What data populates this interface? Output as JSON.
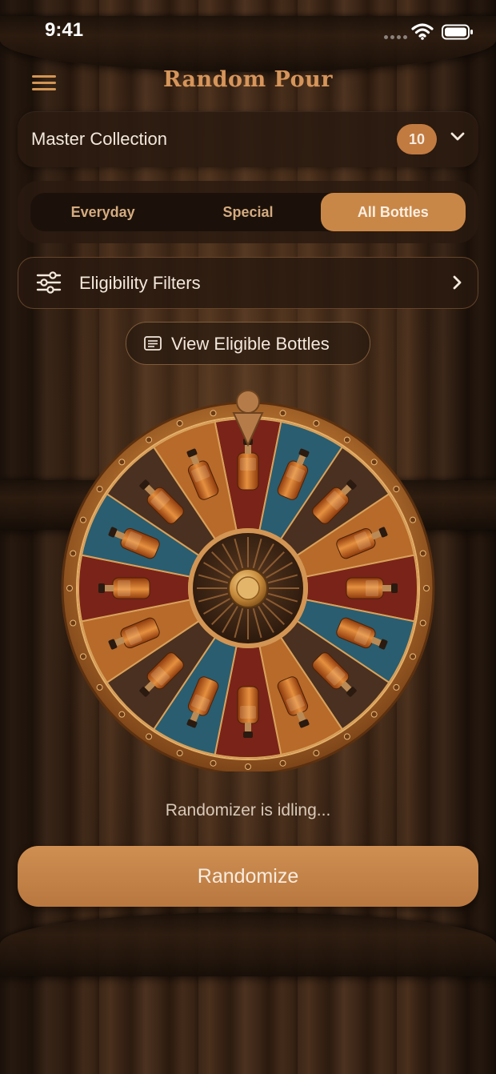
{
  "status_bar": {
    "time": "9:41"
  },
  "header": {
    "title": "Random Pour"
  },
  "collection": {
    "name": "Master Collection",
    "count": "10"
  },
  "segments": [
    {
      "label": "Everyday",
      "active": false
    },
    {
      "label": "Special",
      "active": false
    },
    {
      "label": "All Bottles",
      "active": true
    }
  ],
  "filters": {
    "label": "Eligibility Filters"
  },
  "view_button": {
    "label": "View Eligible Bottles"
  },
  "wheel": {
    "segment_count": 16,
    "colors": [
      "#7a2318",
      "#2a5d70",
      "#4a3020",
      "#b86a2a"
    ]
  },
  "status_text": "Randomizer is idling...",
  "randomize_button": {
    "label": "Randomize"
  },
  "colors": {
    "accent": "#c98747",
    "title": "#d6955a",
    "text": "#f3e8dc"
  }
}
